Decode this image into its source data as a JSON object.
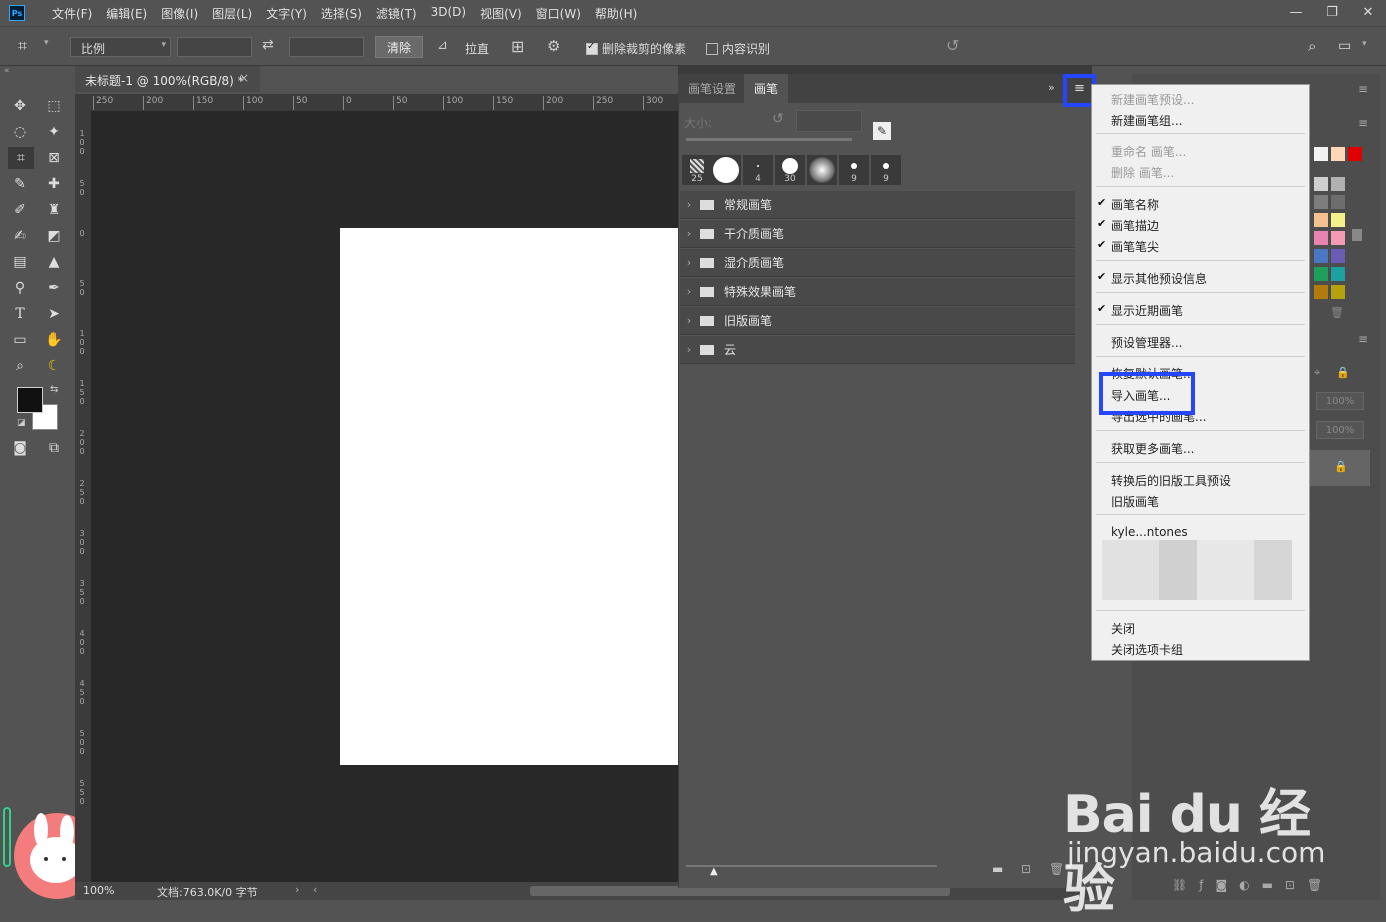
{
  "menubar": {
    "logo": "Ps",
    "items": [
      "文件(F)",
      "编辑(E)",
      "图像(I)",
      "图层(L)",
      "文字(Y)",
      "选择(S)",
      "滤镜(T)",
      "3D(D)",
      "视图(V)",
      "窗口(W)",
      "帮助(H)"
    ],
    "window_controls": [
      "minimize-icon",
      "restore-icon",
      "close-icon"
    ]
  },
  "options_bar": {
    "ratio_select": "比例",
    "clear_button": "清除",
    "straighten_label": "拉直",
    "delete_cropped_label": "删除裁剪的像素",
    "delete_cropped_checked": true,
    "content_aware_label": "内容识别",
    "content_aware_checked": false
  },
  "document": {
    "tab_title": "未标题-1 @ 100%(RGB/8) *",
    "tab_close": "×",
    "ruler_ticks": [
      "250",
      "200",
      "150",
      "100",
      "50",
      "0",
      "50",
      "100",
      "150",
      "200",
      "250",
      "300"
    ],
    "ruler_v_ticks": [
      "1\n0\n0",
      "5\n0",
      "0",
      "5\n0",
      "1\n0\n0",
      "1\n5\n0",
      "2\n0\n0",
      "2\n5\n0",
      "3\n0\n0",
      "3\n5\n0",
      "4\n0\n0",
      "4\n5\n0",
      "5\n0\n0",
      "5\n5\n0"
    ],
    "zoom": "100%",
    "doc_info": "文档:763.0K/0 字节"
  },
  "brush_panel": {
    "tabs": [
      "画笔设置",
      "画笔"
    ],
    "active_tab": "画笔",
    "size_label": "大小:",
    "tips": [
      "25",
      "",
      "4",
      "30",
      "",
      "9",
      "9"
    ],
    "groups": [
      "常规画笔",
      "干介质画笔",
      "湿介质画笔",
      "特殊效果画笔",
      "旧版画笔",
      "云"
    ]
  },
  "flyout_menu": {
    "items": [
      {
        "label": "新建画笔预设...",
        "disabled": true,
        "checked": false
      },
      {
        "label": "新建画笔组...",
        "disabled": false,
        "checked": false
      },
      {
        "label": "重命名 画笔...",
        "disabled": true,
        "checked": false
      },
      {
        "label": "删除 画笔...",
        "disabled": true,
        "checked": false
      },
      {
        "label": "画笔名称",
        "disabled": false,
        "checked": true
      },
      {
        "label": "画笔描边",
        "disabled": false,
        "checked": true
      },
      {
        "label": "画笔笔尖",
        "disabled": false,
        "checked": true
      },
      {
        "label": "显示其他预设信息",
        "disabled": false,
        "checked": true
      },
      {
        "label": "显示近期画笔",
        "disabled": false,
        "checked": true
      },
      {
        "label": "预设管理器...",
        "disabled": false,
        "checked": false
      },
      {
        "label": "恢复默认画笔...",
        "disabled": false,
        "checked": false
      },
      {
        "label": "导入画笔...",
        "disabled": false,
        "checked": false
      },
      {
        "label": "导出选中的画笔...",
        "disabled": false,
        "checked": false
      },
      {
        "label": "获取更多画笔...",
        "disabled": false,
        "checked": false
      },
      {
        "label": "转换后的旧版工具预设",
        "disabled": false,
        "checked": false
      },
      {
        "label": "旧版画笔",
        "disabled": false,
        "checked": false
      },
      {
        "label": "kyle...ntones",
        "disabled": false,
        "checked": false
      },
      {
        "label": "关闭",
        "disabled": false,
        "checked": false
      },
      {
        "label": "关闭选项卡组",
        "disabled": false,
        "checked": false
      }
    ]
  },
  "right_panels": {
    "opacity": "100%",
    "fill": "100%"
  },
  "watermark": {
    "brand": "Bai du 经验",
    "url": "jingyan.baidu.com"
  },
  "colors": {
    "highlight": "#2546ff",
    "foreground": "#111111",
    "background": "#ffffff"
  }
}
